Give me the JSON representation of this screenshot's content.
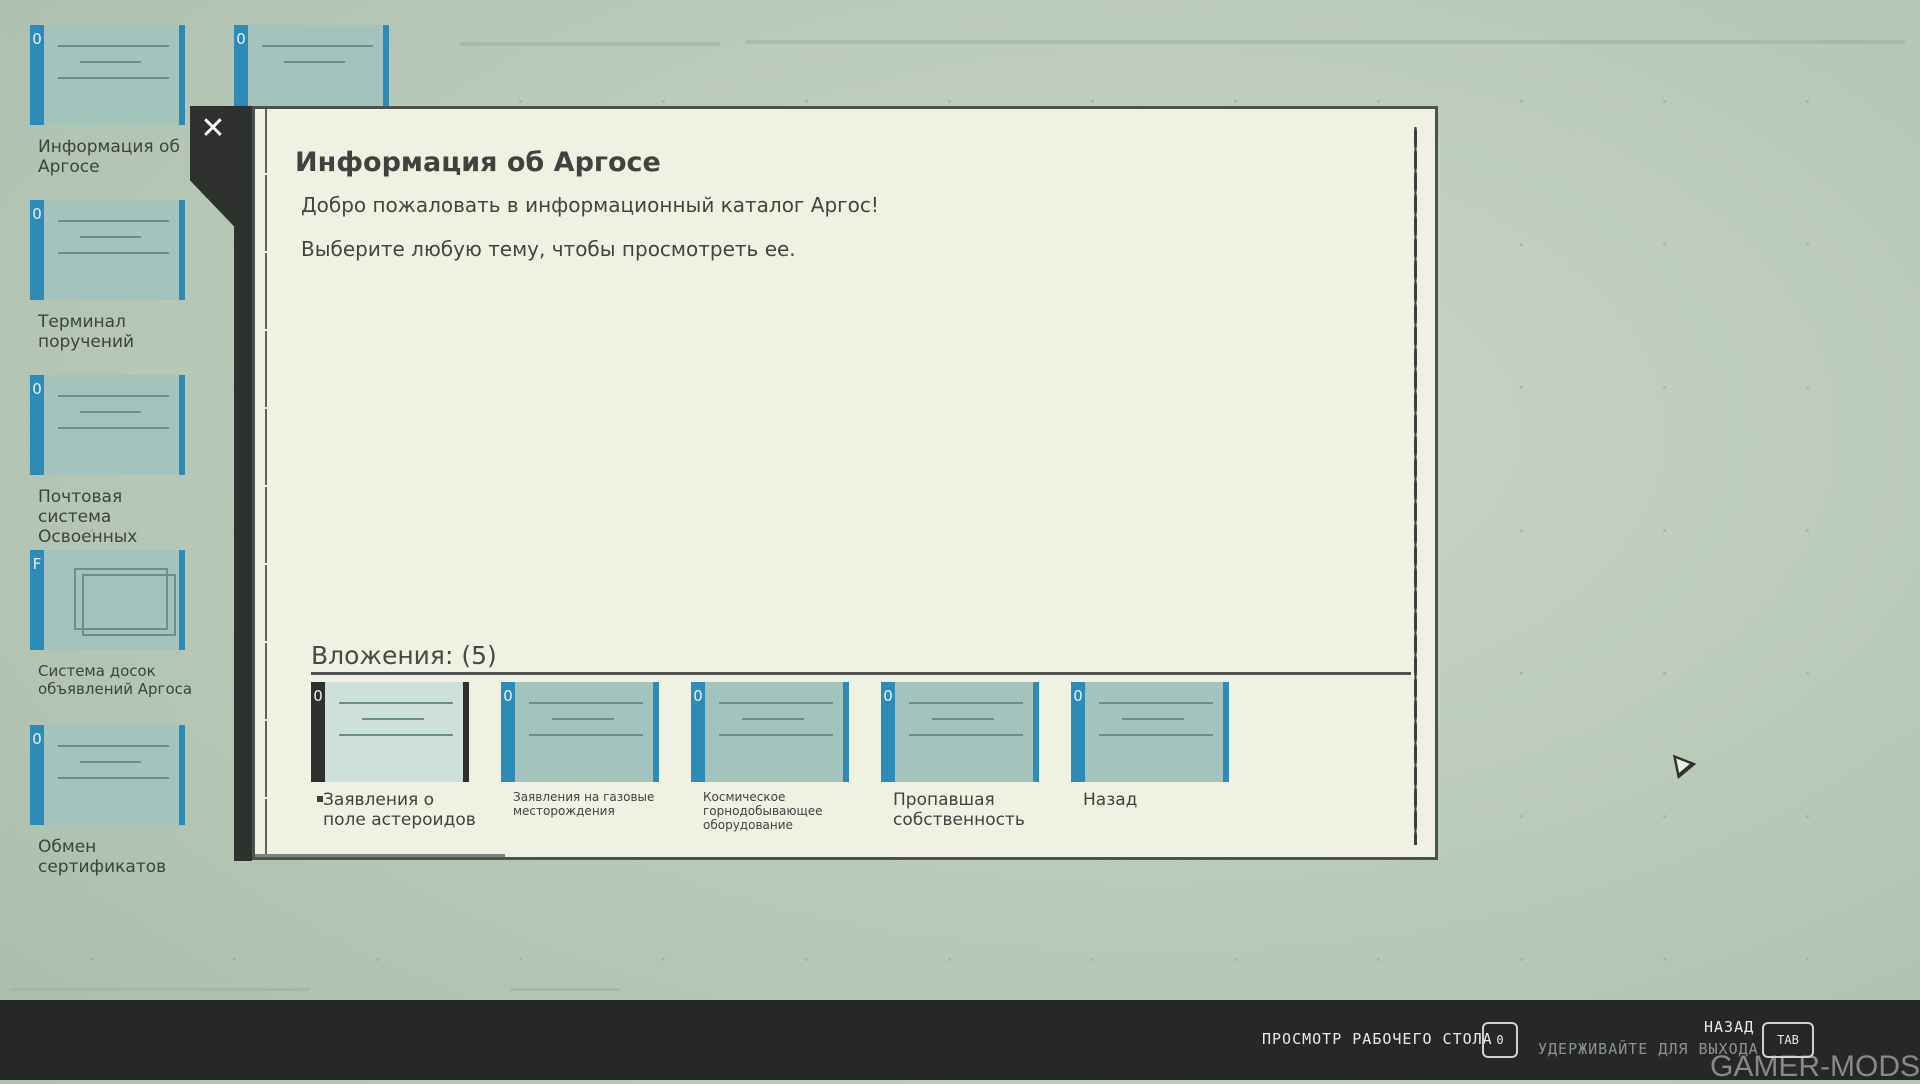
{
  "desktop": {
    "icons": [
      {
        "hotkey": "0",
        "label": "Информация об Аргосе"
      },
      {
        "hotkey": "0",
        "label": "Терминал поручений"
      },
      {
        "hotkey": "0",
        "label": "Почтовая система Освоенных систем"
      },
      {
        "hotkey": "F",
        "label": "Система досок объявлений Аргоса"
      },
      {
        "hotkey": "0",
        "label": "Обмен сертификатов"
      },
      {
        "hotkey": "0",
        "label": ""
      }
    ]
  },
  "window": {
    "close_icon": "close-icon",
    "title": "Информация об Аргосе",
    "paragraph1": "Добро пожаловать в информационный каталог Аргос!",
    "paragraph2": "Выберите любую тему, чтобы просмотреть ее.",
    "attachments_heading": "Вложения: (5)",
    "attachments": [
      {
        "hotkey": "0",
        "label": "Заявления о поле астероидов",
        "selected": true
      },
      {
        "hotkey": "0",
        "label": "Заявления на газовые месторождения"
      },
      {
        "hotkey": "0",
        "label": "Космическое горнодобывающее оборудование"
      },
      {
        "hotkey": "0",
        "label": "Пропавшая собственность"
      },
      {
        "hotkey": "0",
        "label": "Назад"
      }
    ]
  },
  "bottom_bar": {
    "desktop_view": "ПРОСМОТР РАБОЧЕГО СТОЛА",
    "desktop_key": "0",
    "back": "НАЗАД",
    "hold_to_exit": "УДЕРЖИВАЙТЕ ДЛЯ ВЫХОДА",
    "back_key": "TAB"
  },
  "watermark": "GAMER-MODS",
  "colors": {
    "accent": "#2d8bb8",
    "paper": "#f1f1e3",
    "frame": "#2f312f"
  }
}
